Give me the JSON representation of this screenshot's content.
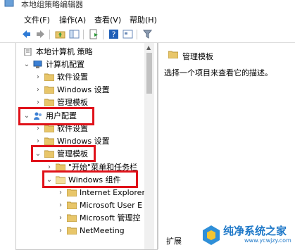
{
  "window": {
    "title": "本地组策略编辑器"
  },
  "menu": {
    "items": [
      "文件(F)",
      "操作(A)",
      "查看(V)",
      "帮助(H)"
    ]
  },
  "tree": {
    "root": "本地计算机 策略",
    "computer_config": "计算机配置",
    "cc_children": [
      "软件设置",
      "Windows 设置",
      "管理模板"
    ],
    "user_config": "用户配置",
    "uc_children": [
      "软件设置",
      "Windows 设置"
    ],
    "admin_templates": "管理模板",
    "start_menu": "\"开始\"菜单和任务栏",
    "win_components": "Windows 组件",
    "wc_children": [
      "Internet Explorer",
      "Microsoft User E",
      "Microsoft 管理控",
      "NetMeeting"
    ]
  },
  "right": {
    "header": "管理模板",
    "description": "选择一个项目来查看它的描述。"
  },
  "tabs": {
    "extended": "扩展"
  },
  "watermark": {
    "main": "纯净系统之家",
    "sub": "www.ycwjzy.com"
  },
  "colors": {
    "highlight": "#e0121a",
    "folder": "#e8c66a",
    "accent": "#1e78c8"
  }
}
